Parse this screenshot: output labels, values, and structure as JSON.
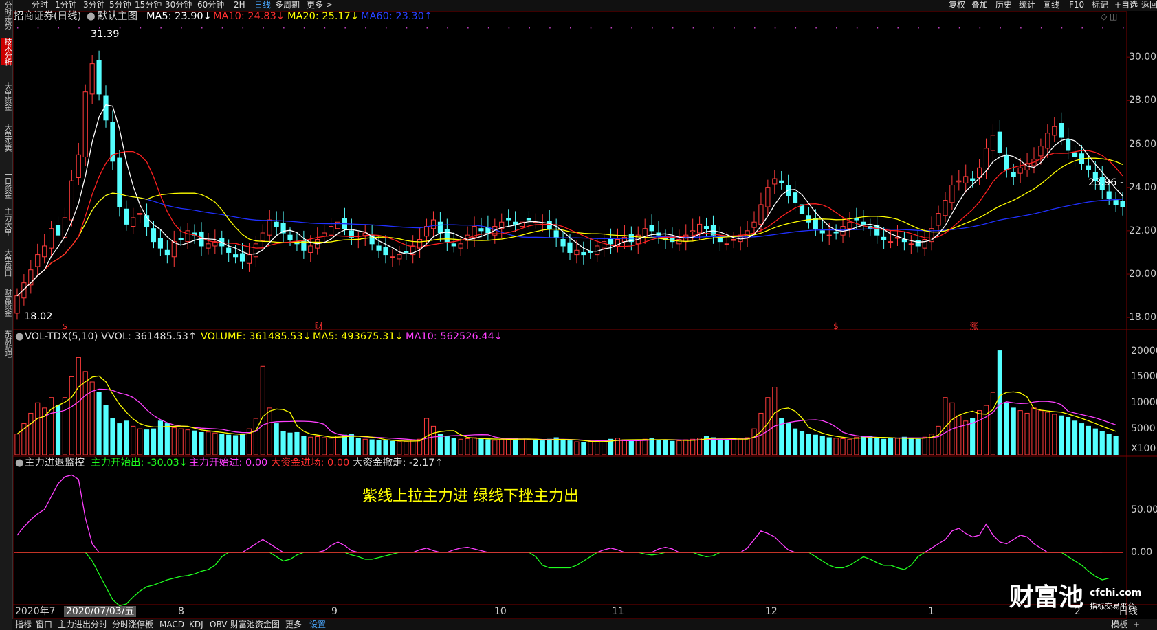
{
  "toolbar": {
    "left": [
      "分时",
      "1分钟",
      "3分钟",
      "5分钟",
      "15分钟",
      "30分钟",
      "60分钟",
      "2H",
      "日线",
      "多周期",
      "更多 >"
    ],
    "right": [
      "复权",
      "叠加",
      "历史",
      "统计",
      "画线",
      "F10",
      "标记",
      "+自选",
      "返回"
    ]
  },
  "sidebar": [
    "分时走势",
    "技术分析",
    "大单资金",
    "大单买卖",
    "一日资金",
    "主力大单",
    "大单盘口",
    "财富资金",
    "东财贴吧"
  ],
  "main_panel": {
    "title": "招商证券(日线)",
    "main_label": "默认主图",
    "ma5": "MA5: 23.90↓",
    "ma10": "MA10: 24.83↓",
    "ma20": "MA20: 25.17↓",
    "ma60": "MA60: 23.30↑",
    "high_label": "31.39",
    "low_label": "18.02",
    "last_label": "23.96 -",
    "yticks": [
      "30.00",
      "28.00",
      "26.00",
      "24.00",
      "22.00",
      "20.00",
      "18.00"
    ],
    "markers": [
      "$",
      "财",
      "$",
      "涨"
    ]
  },
  "vol_panel": {
    "name": "VOL-TDX(5,10) VVOL: 361485.53↑",
    "volume": "VOLUME: 361485.53↓",
    "ma5": "MA5: 493675.31↓",
    "ma10": "MA10: 562526.44↓",
    "yticks": [
      "20000",
      "15000",
      "10000",
      "5000",
      "X100"
    ]
  },
  "flow_panel": {
    "name": "主力进退监控",
    "start_out": "主力开始出: -30.03↓",
    "start_in": "主力开始进: 0.00",
    "big_in": "大资金进场: 0.00",
    "big_out": "大资金撤走: -2.17↑",
    "annotation": "紫线上拉主力进 绿线下挫主力出",
    "yticks": [
      "50.00",
      "0.00"
    ]
  },
  "date_axis": {
    "year": "2020年7",
    "cursor_date": "2020/07/03/五",
    "months": [
      "8",
      "9",
      "10",
      "11",
      "12",
      "1",
      "2"
    ],
    "right_label": "日线"
  },
  "bottom_tabs": [
    "指标",
    "窗口",
    "主力进出分时",
    "分时涨停板",
    "MACD",
    "KDJ",
    "OBV",
    "财富池资金图",
    "更多",
    "设置"
  ],
  "bottom_right": [
    "模板",
    "+",
    "-"
  ],
  "logo": {
    "main": "财富池",
    "site": "cfchi.com",
    "tagline": "指标交易平台"
  },
  "chart_data": {
    "type": "candlestick",
    "closes": [
      19.0,
      19.6,
      20.2,
      20.9,
      21.3,
      22.1,
      21.8,
      22.6,
      24.3,
      25.5,
      28.4,
      29.7,
      28.3,
      27.1,
      25.2,
      23.1,
      22.3,
      22.6,
      22.8,
      22.2,
      21.5,
      21.2,
      20.9,
      21.5,
      21.6,
      22.0,
      21.8,
      21.3,
      21.4,
      21.5,
      21.3,
      21.0,
      20.8,
      20.6,
      20.9,
      21.4,
      21.9,
      22.5,
      22.2,
      21.9,
      21.6,
      21.4,
      21.1,
      21.3,
      21.6,
      21.9,
      22.2,
      22.4,
      22.1,
      21.7,
      21.6,
      21.9,
      21.4,
      21.1,
      20.9,
      20.8,
      20.9,
      21.0,
      21.3,
      21.6,
      22.2,
      22.5,
      21.9,
      21.5,
      21.3,
      21.4,
      21.8,
      22.2,
      22.0,
      21.9,
      22.2,
      22.4,
      22.5,
      22.3,
      22.4,
      22.5,
      22.4,
      22.3,
      22.1,
      21.7,
      21.3,
      21.0,
      21.1,
      20.9,
      21.0,
      21.3,
      21.5,
      21.4,
      21.6,
      21.7,
      21.5,
      21.8,
      22.1,
      22.0,
      21.8,
      21.6,
      21.5,
      21.6,
      21.8,
      22.0,
      22.3,
      22.1,
      21.8,
      21.5,
      21.4,
      21.6,
      21.8,
      22.0,
      22.4,
      23.2,
      24.0,
      24.4,
      24.2,
      23.6,
      23.3,
      22.8,
      22.4,
      22.1,
      21.9,
      21.8,
      21.9,
      22.2,
      22.4,
      22.5,
      22.3,
      22.1,
      21.8,
      21.6,
      21.5,
      21.7,
      21.5,
      21.4,
      21.3,
      21.6,
      22.1,
      22.8,
      23.4,
      24.1,
      24.3,
      24.5,
      24.3,
      24.9,
      25.8,
      26.4,
      25.6,
      24.8,
      24.5,
      24.9,
      25.1,
      25.3,
      25.9,
      26.5,
      26.8,
      26.3,
      25.7,
      25.4,
      25.1,
      24.8,
      24.3,
      23.9,
      23.5,
      23.2,
      23.1
    ],
    "volumes": [
      4000,
      6000,
      8000,
      10000,
      9000,
      11000,
      9500,
      11000,
      15000,
      18700,
      16000,
      14000,
      12000,
      9500,
      7000,
      6000,
      6500,
      5500,
      5000,
      4800,
      5000,
      6500,
      6000,
      5200,
      5000,
      4800,
      4600,
      4300,
      4400,
      4200,
      4000,
      3800,
      3700,
      4000,
      5000,
      7000,
      17000,
      9000,
      6000,
      4500,
      4200,
      4300,
      3600,
      3400,
      3500,
      3300,
      3200,
      3600,
      3800,
      4000,
      3200,
      3000,
      2900,
      2800,
      2700,
      2600,
      2500,
      2600,
      2800,
      3000,
      7000,
      5500,
      4000,
      3500,
      3200,
      3000,
      3100,
      3300,
      3100,
      2900,
      2800,
      3000,
      3200,
      3100,
      3000,
      2900,
      2800,
      2700,
      3000,
      3300,
      2900,
      2700,
      2500,
      2400,
      2500,
      2600,
      2700,
      3000,
      3200,
      2900,
      2700,
      2800,
      3000,
      3100,
      2900,
      2800,
      2600,
      2700,
      2900,
      3000,
      3200,
      3500,
      3300,
      3000,
      2800,
      2900,
      3100,
      3300,
      5000,
      8000,
      11000,
      13000,
      7000,
      6000,
      5000,
      4500,
      4000,
      3800,
      3500,
      3300,
      3200,
      3100,
      3000,
      3400,
      3600,
      3500,
      3300,
      3000,
      3100,
      3200,
      3400,
      3100,
      3000,
      3400,
      4000,
      5500,
      11000,
      10000,
      7500,
      6500,
      7000,
      8500,
      9500,
      12000,
      20000,
      10000,
      9000,
      8500,
      8000,
      9000,
      8500,
      8200,
      7800,
      7500,
      7200,
      6500,
      6000,
      5500,
      5000,
      4500,
      4000,
      3600
    ],
    "flow_purple": [
      20,
      30,
      38,
      45,
      50,
      65,
      80,
      88,
      90,
      85,
      40,
      10,
      0,
      0,
      0,
      0,
      0,
      0,
      0,
      0,
      0,
      0,
      0,
      0,
      0,
      0,
      0,
      0,
      0,
      0,
      0,
      0,
      0,
      0,
      5,
      10,
      15,
      10,
      5,
      0,
      0,
      0,
      0,
      0,
      0,
      2,
      8,
      12,
      8,
      2,
      0,
      0,
      0,
      0,
      0,
      0,
      0,
      0,
      0,
      3,
      5,
      2,
      0,
      0,
      3,
      5,
      6,
      4,
      2,
      0,
      0,
      0,
      0,
      0,
      0,
      0,
      0,
      0,
      0,
      0,
      0,
      0,
      0,
      0,
      0,
      0,
      3,
      5,
      3,
      0,
      0,
      0,
      0,
      0,
      4,
      6,
      4,
      0,
      0,
      0,
      0,
      0,
      0,
      0,
      0,
      0,
      0,
      5,
      15,
      25,
      22,
      18,
      10,
      3,
      0,
      0,
      0,
      0,
      0,
      0,
      0,
      0,
      0,
      0,
      0,
      0,
      0,
      0,
      0,
      0,
      0,
      0,
      0,
      0,
      5,
      10,
      15,
      25,
      28,
      22,
      18,
      20,
      33,
      20,
      12,
      10,
      15,
      20,
      18,
      10,
      5,
      0,
      0,
      0,
      0,
      0,
      0,
      0,
      0,
      0
    ],
    "flow_green": [
      0,
      0,
      0,
      0,
      0,
      0,
      0,
      0,
      0,
      0,
      0,
      -10,
      -25,
      -40,
      -55,
      -62,
      -60,
      -52,
      -45,
      -40,
      -38,
      -35,
      -32,
      -30,
      -28,
      -27,
      -25,
      -22,
      -20,
      -15,
      -5,
      0,
      0,
      0,
      0,
      0,
      0,
      0,
      -5,
      -10,
      -8,
      -3,
      0,
      0,
      0,
      0,
      0,
      0,
      0,
      -3,
      -5,
      -8,
      -8,
      -6,
      -4,
      -2,
      0,
      0,
      0,
      0,
      0,
      0,
      0,
      0,
      0,
      0,
      0,
      0,
      0,
      0,
      0,
      0,
      0,
      0,
      0,
      0,
      -5,
      -15,
      -18,
      -18,
      -18,
      -18,
      -15,
      -10,
      -5,
      0,
      0,
      0,
      0,
      0,
      0,
      0,
      -2,
      -3,
      -2,
      0,
      0,
      0,
      0,
      0,
      -3,
      -5,
      -4,
      0,
      0,
      0,
      0,
      0,
      0,
      0,
      0,
      0,
      0,
      0,
      0,
      0,
      0,
      -5,
      -10,
      -15,
      -18,
      -18,
      -15,
      -10,
      -5,
      -8,
      -12,
      -15,
      -15,
      -18,
      -20,
      -15,
      -5,
      0,
      0,
      0,
      0,
      0,
      0,
      0,
      0,
      0,
      0,
      0,
      0,
      0,
      0,
      0,
      0,
      0,
      0,
      0,
      0,
      0,
      -5,
      -10,
      -15,
      -22,
      -28,
      -32,
      -30
    ],
    "ylim": [
      17.5,
      32.0
    ],
    "colors": {
      "up": "#ff3b3b",
      "down": "#54ffff",
      "ma5": "#ffffff",
      "ma10": "#ff2020",
      "ma20": "#ffff00",
      "ma60": "#2030ff",
      "vma5": "#ffff00",
      "vma10": "#ff40ff",
      "purple": "#ff40ff",
      "green": "#20ff20",
      "red": "#ff3030"
    }
  }
}
